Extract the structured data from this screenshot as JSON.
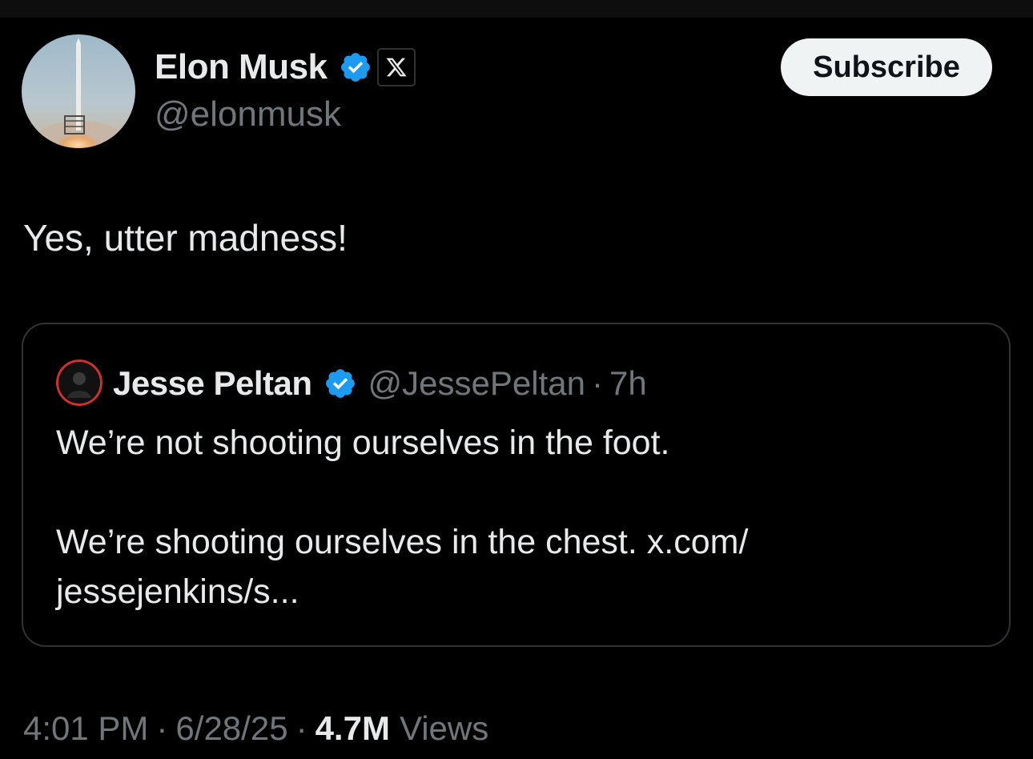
{
  "author": {
    "display_name": "Elon Musk",
    "handle": "@elonmusk",
    "verified": true,
    "affiliate_badge": "x-logo-icon",
    "avatar": "rocket-launch-avatar"
  },
  "actions": {
    "subscribe_label": "Subscribe"
  },
  "tweet": {
    "text": "Yes, utter madness!"
  },
  "quoted_tweet": {
    "display_name": "Jesse Peltan",
    "handle": "@JessePeltan",
    "separator": "·",
    "time": "7h",
    "line1": "We’re not shooting ourselves in the foot.",
    "line2": "We’re shooting ourselves in the chest. x.com/",
    "line3": "jessejenkins/s..."
  },
  "meta": {
    "time": "4:01 PM",
    "date": "6/28/25",
    "views_count": "4.7M",
    "views_label": "Views",
    "separator": "·"
  },
  "colors": {
    "background": "#000000",
    "primary_text": "#e7e9ea",
    "secondary_text": "#71767b",
    "border": "#2f3336",
    "verified_blue": "#1d9bf0",
    "button_bg": "#eff3f4"
  }
}
